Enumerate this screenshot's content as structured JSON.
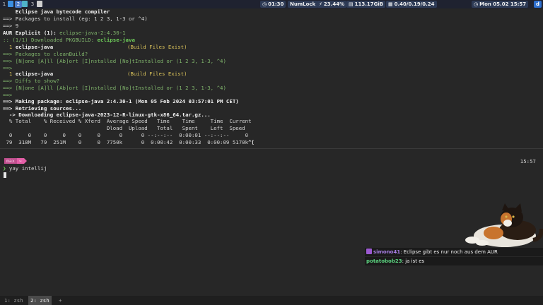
{
  "topbar": {
    "workspaces": [
      {
        "label": "1",
        "active": false
      },
      {
        "label": "2",
        "active": true
      },
      {
        "label": "3",
        "active": false
      }
    ],
    "status": {
      "time": "01:30",
      "numlock": "NumLock",
      "cpu": "23.44%",
      "disk": "113.17GiB",
      "load": "0.40/0.19/0.24",
      "datetime": "Mon 05.02 15:57"
    },
    "tray_icon": "d"
  },
  "terminal_top": {
    "lines": [
      "    Eclipse java bytecode compiler",
      "==> Packages to install (eg: 1 2 3, 1-3 or ^4)",
      "==> 9",
      "AUR Explicit (1):",
      "eclipse-java-2:4.30-1",
      ":: (1/1) Downloaded PKGBUILD:",
      "eclipse-java",
      "  1",
      "eclipse-java",
      "(Build Files Exist)",
      "==> Packages to cleanBuild?",
      "==> [N]one [A]ll [Ab]ort [I]nstalled [No]tInstalled or (1 2 3, 1-3, ^4)",
      "==>",
      "  1",
      "eclipse-java",
      "(Build Files Exist)",
      "==> Diffs to show?",
      "==> [N]one [A]ll [Ab]ort [I]nstalled [No]tInstalled or (1 2 3, 1-3, ^4)",
      "==>",
      "==> Making package: eclipse-java 2:4.30-1 (Mon 05 Feb 2024 03:57:01 PM CET)",
      "==> Retrieving sources...",
      "  -> Downloading eclipse-java-2023-12-R-linux-gtk-x86_64.tar.gz...",
      "  % Total    % Received % Xferd  Average Speed   Time    Time     Time  Current",
      "                                 Dload  Upload   Total   Spent    Left  Speed",
      "  0     0    0     0    0     0      0      0 --:--:--  0:00:01 --:--:--     0",
      " 79  318M   79  251M    0     0  7750k      0  0:00:42  0:00:33  0:00:09 5170k",
      "^["
    ]
  },
  "terminal_bottom": {
    "prompt_user": "max",
    "prompt_dir": "~",
    "clock": "15:57",
    "chevron": "❯",
    "command": " yay intellij"
  },
  "chat": {
    "messages": [
      {
        "user": "simono41",
        "text": ": Eclipse gibt es nur noch aus dem AUR"
      },
      {
        "user": "potatobob23",
        "text": ": ja ist es"
      }
    ]
  },
  "tmux": {
    "tabs": [
      {
        "label": "1: zsh",
        "active": false
      },
      {
        "label": "2: zsh",
        "active": true
      },
      {
        "label": "+",
        "active": false
      }
    ]
  },
  "colors": {
    "terminal_bg": "#272727",
    "accent_green": "#6fcf5a",
    "accent_yellow": "#d8c15a",
    "prompt_pink": "#e45fa8",
    "workspace_active": "#4a7ac8"
  }
}
